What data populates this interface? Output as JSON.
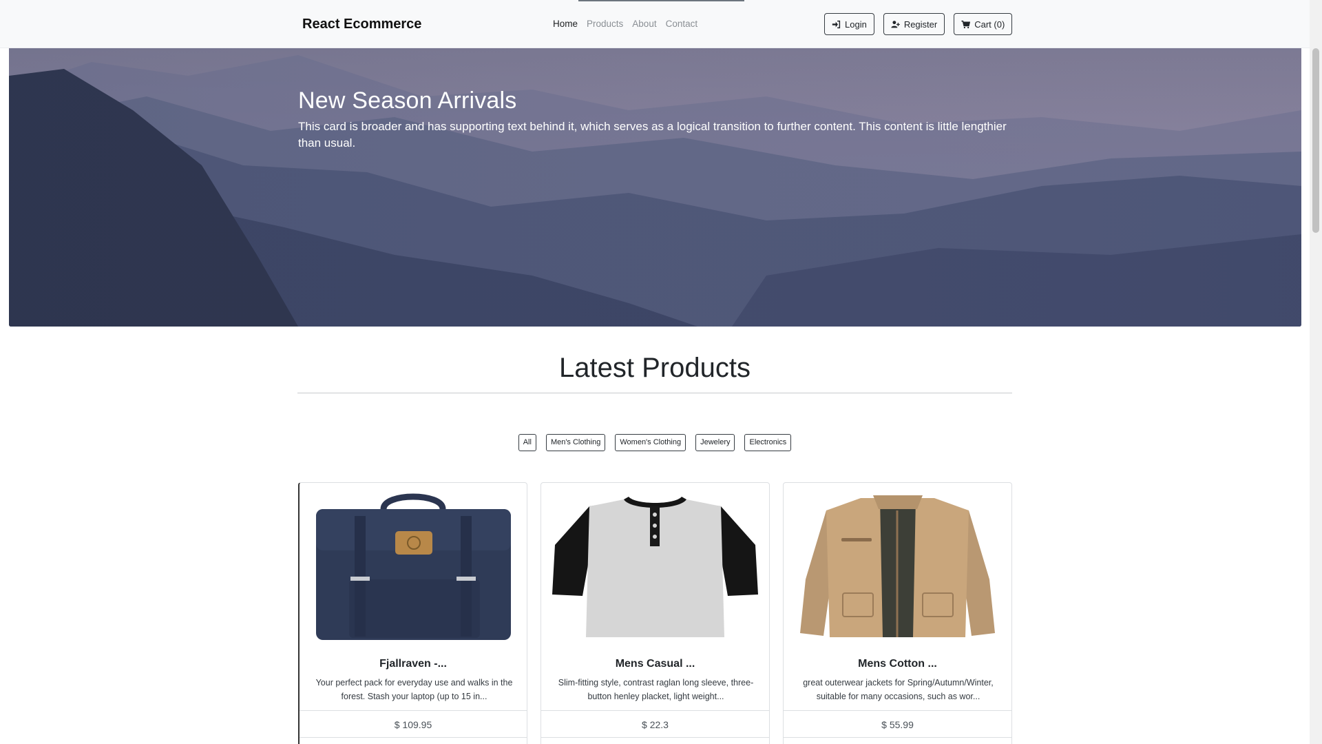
{
  "navbar": {
    "brand": "React Ecommerce",
    "links": [
      "Home",
      "Products",
      "About",
      "Contact"
    ],
    "login_label": "Login",
    "register_label": "Register",
    "cart_label": "Cart (0)"
  },
  "hero": {
    "title": "New Season Arrivals",
    "text": "This card is broader and has supporting text behind it, which serves as a logical transition to further content. This content is little lengthier than usual."
  },
  "products_section": {
    "title": "Latest Products",
    "filters": [
      "All",
      "Men's Clothing",
      "Women's Clothing",
      "Jewelery",
      "Electronics"
    ],
    "items": [
      {
        "title": "Fjallraven -...",
        "description": "Your perfect pack for everyday use and walks in the forest. Stash your laptop (up to 15 in...",
        "price": "$ 109.95",
        "image_icon": "backpack-image"
      },
      {
        "title": "Mens Casual ...",
        "description": "Slim-fitting style, contrast raglan long sleeve, three-button henley placket, light weight...",
        "price": "$ 22.3",
        "image_icon": "tshirt-image"
      },
      {
        "title": "Mens Cotton ...",
        "description": "great outerwear jackets for Spring/Autumn/Winter, suitable for many occasions, such as wor...",
        "price": "$ 55.99",
        "image_icon": "jacket-image"
      }
    ]
  },
  "colors": {
    "navbar_bg": "#f8f9fa",
    "hero_sky": "#8c86a0",
    "hero_mountains": "#2f3a58",
    "button_border": "#343a40"
  }
}
